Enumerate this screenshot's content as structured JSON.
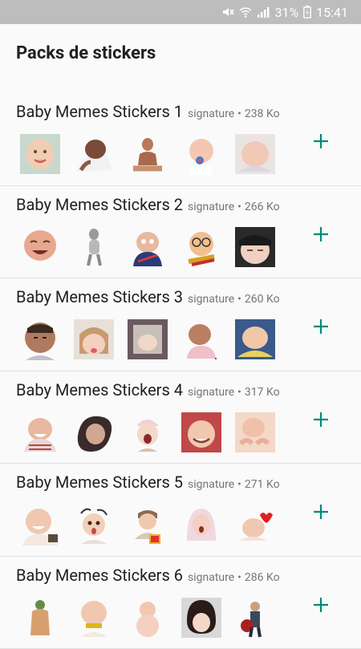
{
  "status_bar": {
    "battery": "31%",
    "time": "15:41",
    "icons": [
      "mute-icon",
      "wifi-icon",
      "signal-icon",
      "battery-charging-icon"
    ]
  },
  "app_bar": {
    "title": "Packs de stickers"
  },
  "packs": [
    {
      "title": "Baby Memes Stickers 1",
      "publisher": "signature",
      "size": "238 Ko"
    },
    {
      "title": "Baby Memes Stickers 2",
      "publisher": "signature",
      "size": "266 Ko"
    },
    {
      "title": "Baby Memes Stickers 3",
      "publisher": "signature",
      "size": "260 Ko"
    },
    {
      "title": "Baby Memes Stickers 4",
      "publisher": "signature",
      "size": "317 Ko"
    },
    {
      "title": "Baby Memes Stickers 5",
      "publisher": "signature",
      "size": "271 Ko"
    },
    {
      "title": "Baby Memes Stickers 6",
      "publisher": "signature",
      "size": "286 Ko"
    }
  ],
  "separator": "•",
  "colors": {
    "accent": "#00897b",
    "status_bar": "#bdbdbd",
    "background": "#fafafa"
  }
}
